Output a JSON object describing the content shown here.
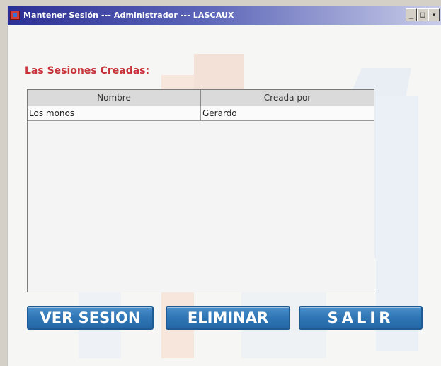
{
  "window": {
    "title": "Mantener Sesión --- Administrador --- LASCAUX",
    "controls": {
      "minimize": "_",
      "maximize": "□",
      "close": "×"
    }
  },
  "heading": "Las Sesiones Creadas:",
  "table": {
    "columns": [
      "Nombre",
      "Creada por"
    ],
    "rows": [
      {
        "nombre": "Los monos",
        "creada_por": "Gerardo"
      }
    ]
  },
  "buttons": {
    "ver_sesion": "VER SESION",
    "eliminar": "ELIMINAR",
    "salir": "SALIR"
  },
  "colors": {
    "heading": "#c8323a",
    "button": "#2f75b5",
    "titlebar_start": "#2c2f94"
  }
}
